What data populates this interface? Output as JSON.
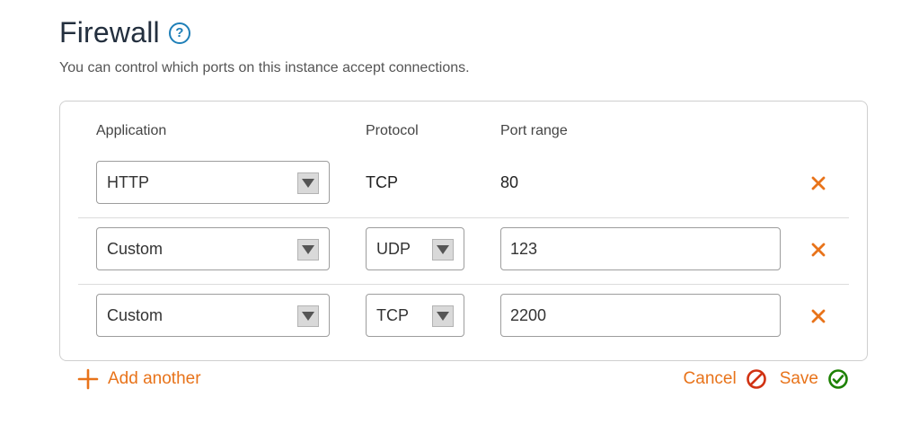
{
  "header": {
    "title": "Firewall",
    "help_icon": "question-circle-icon",
    "subtitle": "You can control which ports on this instance accept connections."
  },
  "columns": {
    "application": "Application",
    "protocol": "Protocol",
    "port_range": "Port range"
  },
  "rules": [
    {
      "application": "HTTP",
      "protocol": "TCP",
      "port_range": "80",
      "protocol_editable": false,
      "port_editable": false
    },
    {
      "application": "Custom",
      "protocol": "UDP",
      "port_range": "123",
      "protocol_editable": true,
      "port_editable": true
    },
    {
      "application": "Custom",
      "protocol": "TCP",
      "port_range": "2200",
      "protocol_editable": true,
      "port_editable": true
    }
  ],
  "footer": {
    "add_label": "Add another",
    "cancel_label": "Cancel",
    "save_label": "Save"
  },
  "colors": {
    "accent": "#e8731a",
    "help": "#1e7fb8",
    "cancel_icon": "#d13212",
    "save_icon": "#1d8102"
  }
}
